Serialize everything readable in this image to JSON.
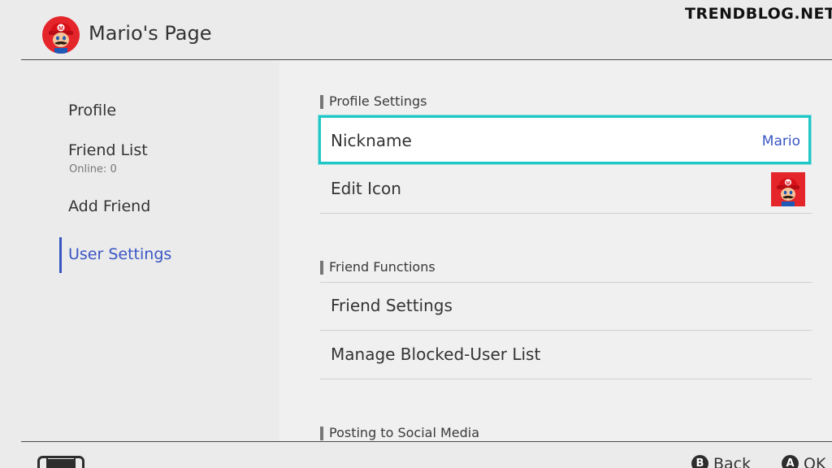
{
  "header": {
    "title": "Mario's Page",
    "avatar_icon": "mario-avatar-icon"
  },
  "watermark": "TRENDBLOG.NET",
  "sidebar": {
    "items": [
      {
        "label": "Profile"
      },
      {
        "label": "Friend List",
        "sub": "Online: 0"
      },
      {
        "label": "Add Friend"
      },
      {
        "label": "User Settings",
        "active": true
      }
    ]
  },
  "main": {
    "profile_settings": {
      "label": "Profile Settings",
      "nickname": {
        "label": "Nickname",
        "value": "Mario"
      },
      "edit_icon": {
        "label": "Edit Icon"
      }
    },
    "friend_functions": {
      "label": "Friend Functions",
      "friend_settings": {
        "label": "Friend Settings"
      },
      "blocked_list": {
        "label": "Manage Blocked-User List"
      }
    },
    "social": {
      "label": "Posting to Social Media"
    }
  },
  "footer": {
    "back": {
      "button": "B",
      "label": "Back"
    },
    "ok": {
      "button": "A",
      "label": "OK"
    }
  },
  "colors": {
    "accent": "#3a55c4",
    "selection": "#22c6c6",
    "mario_red": "#e4262b"
  }
}
